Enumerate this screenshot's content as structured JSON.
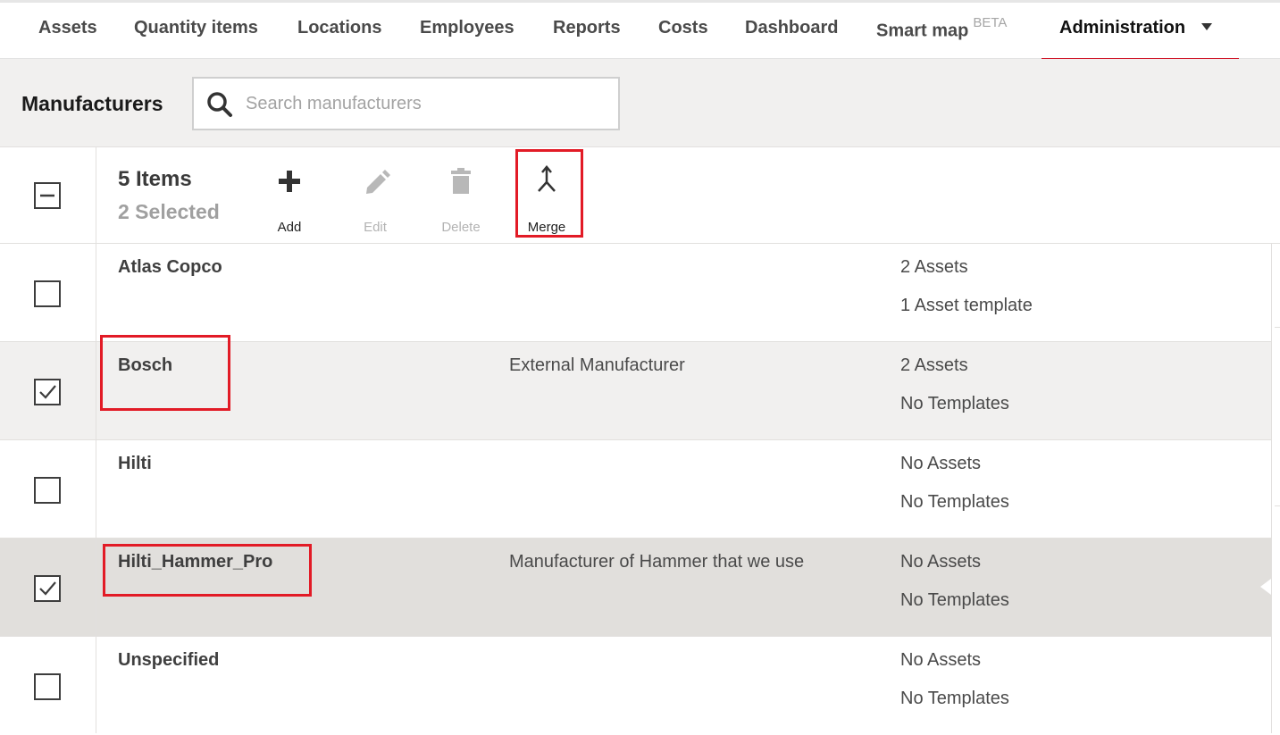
{
  "nav": {
    "items": [
      "Assets",
      "Quantity items",
      "Locations",
      "Employees",
      "Reports",
      "Costs",
      "Dashboard",
      "Smart map"
    ],
    "smart_map_badge": "BETA",
    "active": "Administration",
    "accent_color": "#d0182a"
  },
  "header": {
    "title": "Manufacturers",
    "search_placeholder": "Search manufacturers",
    "search_value": ""
  },
  "toolbar": {
    "count": "5 Items",
    "selected": "2 Selected",
    "select_all_state": "partial",
    "add_label": "Add",
    "edit_label": "Edit",
    "delete_label": "Delete",
    "merge_label": "Merge"
  },
  "rows": [
    {
      "name": "Atlas Copco",
      "description": "",
      "assets": "2 Assets",
      "templates": "1 Asset template",
      "checked": false
    },
    {
      "name": "Bosch",
      "description": "External Manufacturer",
      "assets": "2 Assets",
      "templates": "No Templates",
      "checked": true
    },
    {
      "name": "Hilti",
      "description": "",
      "assets": "No Assets",
      "templates": "No Templates",
      "checked": false
    },
    {
      "name": "Hilti_Hammer_Pro",
      "description": "Manufacturer of Hammer that we use",
      "assets": "No Assets",
      "templates": "No Templates",
      "checked": true
    },
    {
      "name": "Unspecified",
      "description": "",
      "assets": "No Assets",
      "templates": "No Templates",
      "checked": false
    }
  ],
  "colors": {
    "row_selected": "#f1f0ef",
    "row_active": "#e1dfdc",
    "highlight": "#e21b26"
  }
}
